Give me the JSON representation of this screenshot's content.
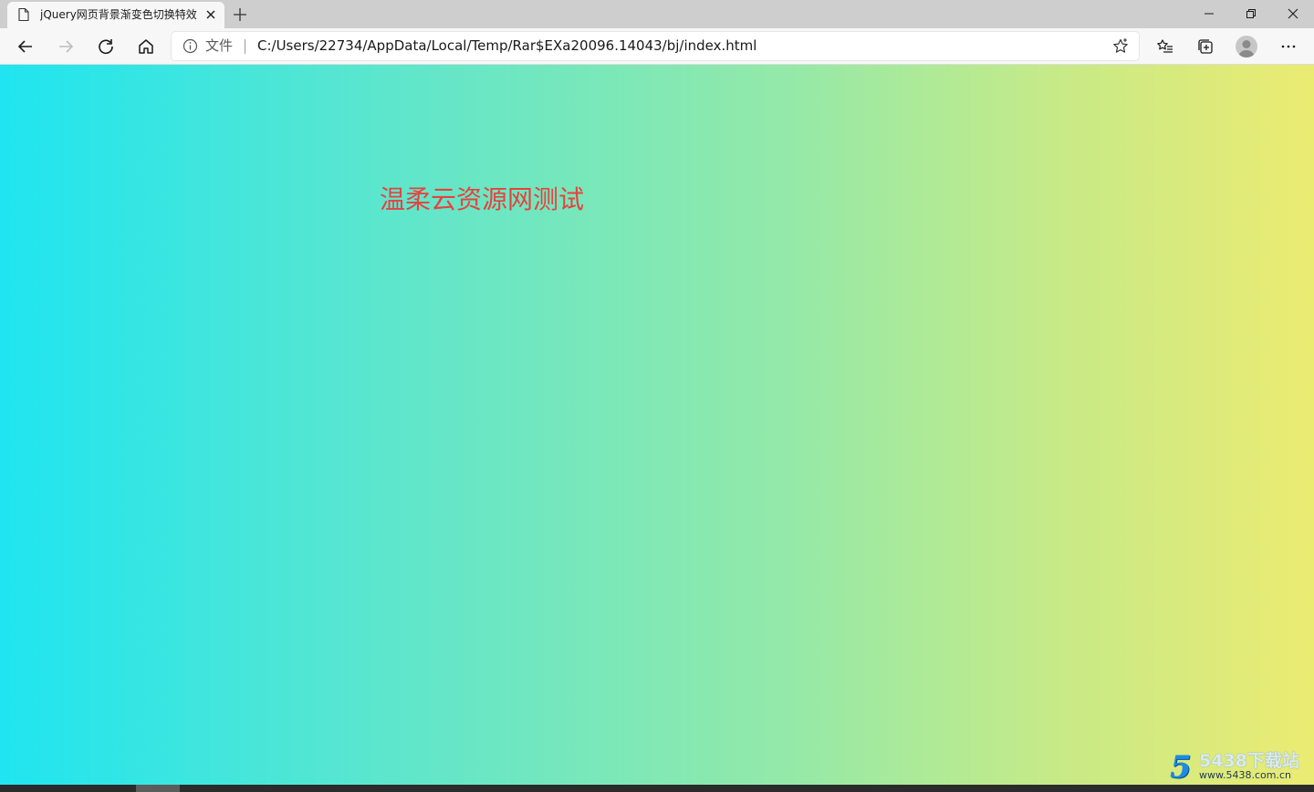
{
  "tab": {
    "title": "jQuery网页背景渐变色切换特效",
    "favicon": "page-icon",
    "close": "close-icon"
  },
  "window_controls": [
    "minimize-icon",
    "restore-icon",
    "close-icon"
  ],
  "toolbar": {
    "buttons": [
      "back-icon",
      "forward-icon",
      "refresh-icon",
      "home-icon"
    ],
    "right_buttons": [
      "favorites-icon",
      "collections-icon",
      "avatar",
      "more-icon"
    ]
  },
  "address": {
    "origin_label": "文件",
    "url": "C:/Users/22734/AppData/Local/Temp/Rar$EXa20096.14043/bj/index.html"
  },
  "page": {
    "text": "温柔云资源网测试",
    "text_color": "#e8413f",
    "gradient_start": "#1fe5f0",
    "gradient_end": "#ebeb72"
  },
  "watermark": {
    "digit": "5",
    "name": "5438下载站",
    "domain": "www.5438.com.cn"
  }
}
